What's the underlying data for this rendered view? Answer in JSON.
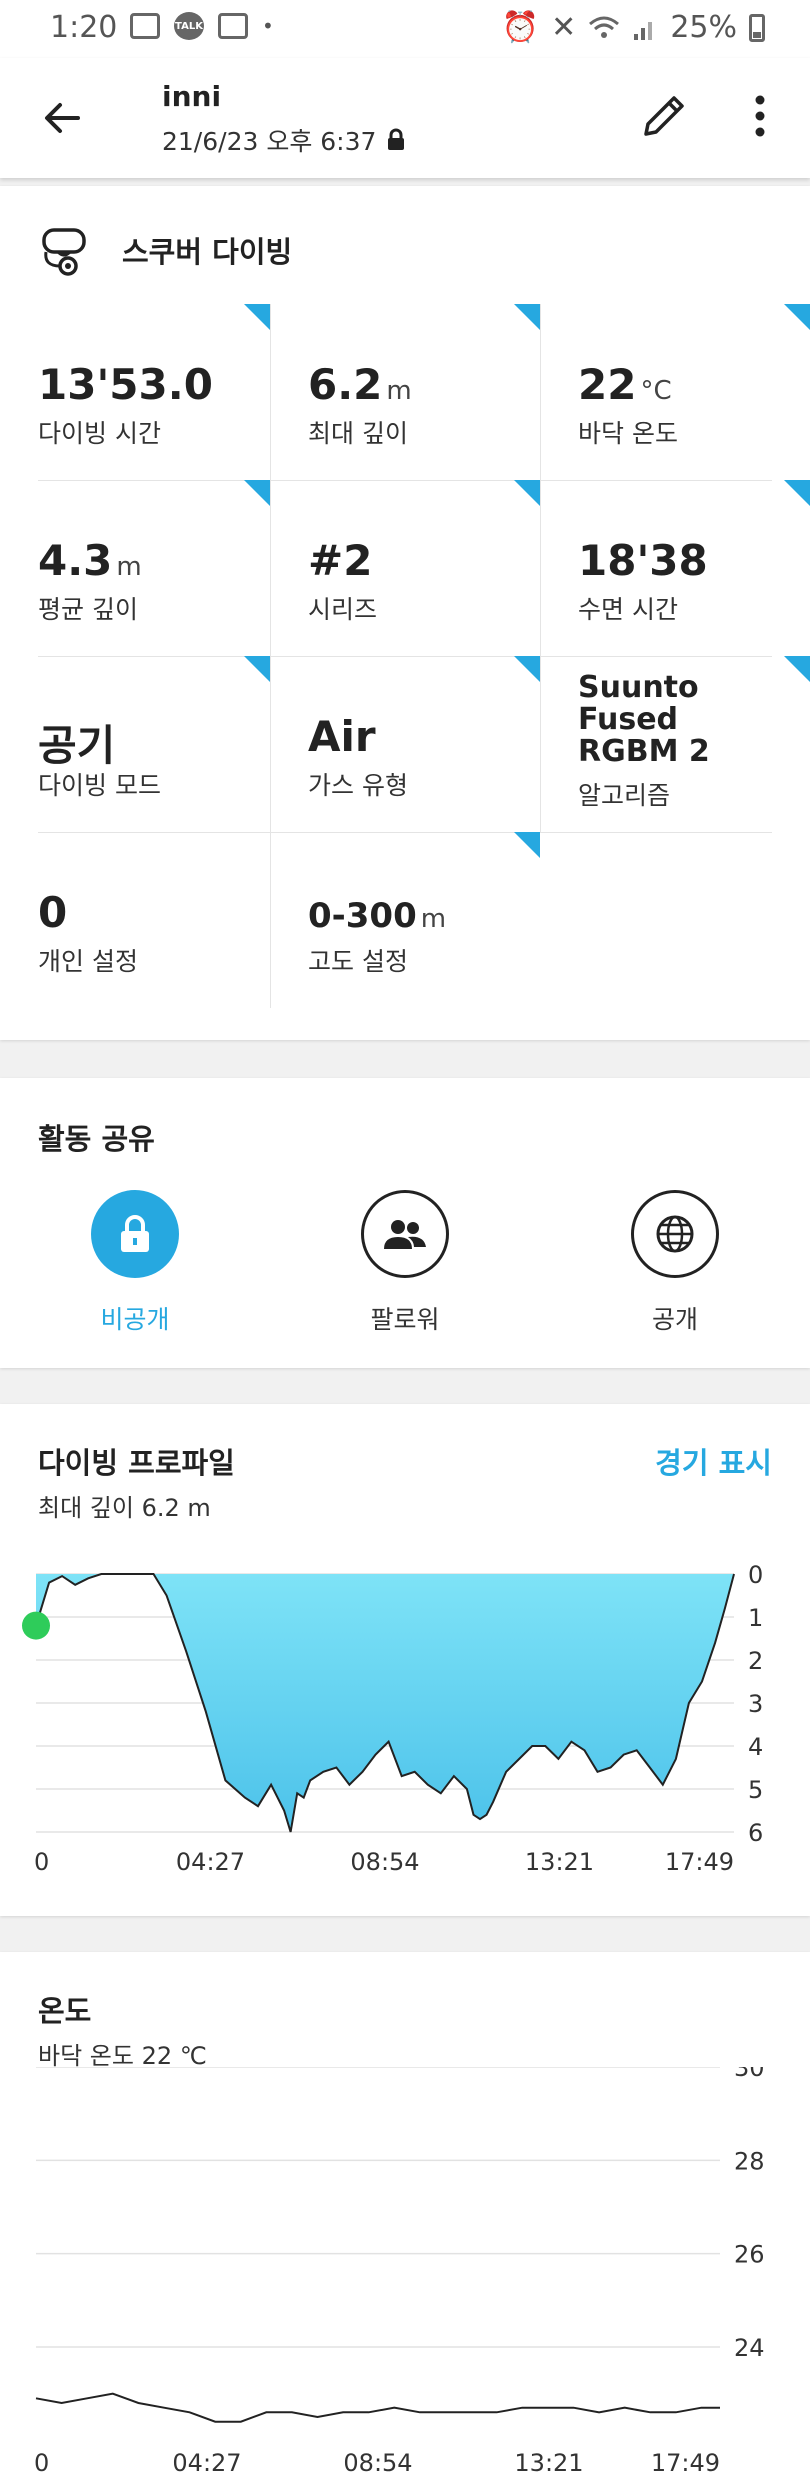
{
  "status_bar": {
    "time": "1:20",
    "battery": "25%",
    "talk_badge": "TALK"
  },
  "header": {
    "title": "inni",
    "subtitle": "21/6/23 오후 6:37"
  },
  "dive": {
    "title": "스쿠버 다이빙",
    "stats": [
      {
        "value": "13'53.0",
        "unit": "",
        "label": "다이빙 시간"
      },
      {
        "value": "6.2",
        "unit": "m",
        "label": "최대 깊이"
      },
      {
        "value": "22",
        "unit": "°C",
        "label": "바닥 온도"
      },
      {
        "value": "4.3",
        "unit": "m",
        "label": "평균 깊이"
      },
      {
        "value": "#2",
        "unit": "",
        "label": "시리즈"
      },
      {
        "value": "18'38",
        "unit": "",
        "label": "수면 시간"
      },
      {
        "value": "공기",
        "unit": "",
        "label": "다이빙 모드"
      },
      {
        "value": "Air",
        "unit": "",
        "label": "가스 유형"
      },
      {
        "value": "Suunto Fused RGBM 2",
        "unit": "",
        "label": "알고리즘"
      },
      {
        "value": "0",
        "unit": "",
        "label": "개인 설정"
      },
      {
        "value": "0-300",
        "unit": "m",
        "label": "고도 설정"
      }
    ]
  },
  "share": {
    "title": "활동 공유",
    "options": [
      {
        "label": "비공개",
        "icon": "lock-icon",
        "active": true
      },
      {
        "label": "팔로워",
        "icon": "followers-icon",
        "active": false
      },
      {
        "label": "공개",
        "icon": "globe-icon",
        "active": false
      }
    ]
  },
  "profile": {
    "title": "다이빙 프로파일",
    "link": "경기 표시",
    "subtitle": "최대 깊이 6.2 m"
  },
  "temperature": {
    "title": "온도",
    "subtitle": "바닥 온도 22 ℃"
  },
  "colors": {
    "accent": "#26a8e0",
    "depth_fill_top": "#7ee3f7",
    "depth_fill_bottom": "#4cc2ea",
    "marker": "#2ecc5a"
  },
  "chart_data": [
    {
      "type": "area",
      "title": "",
      "x_ticks": [
        "0",
        "04:27",
        "08:54",
        "13:21",
        "17:49"
      ],
      "y_ticks": [
        "0",
        "1",
        "2",
        "3",
        "4",
        "5",
        "6"
      ],
      "y_inverted": true,
      "ylim": [
        0,
        6
      ],
      "xlim_seconds": [
        0,
        1069
      ],
      "series": [
        {
          "x_seconds": [
            0,
            20,
            40,
            60,
            80,
            100,
            120,
            140,
            160,
            180,
            200,
            230,
            260,
            290,
            320,
            340,
            360,
            380,
            390,
            400,
            410,
            420,
            440,
            460,
            480,
            500,
            520,
            540,
            560,
            580,
            600,
            620,
            640,
            660,
            670,
            680,
            690,
            700,
            720,
            740,
            760,
            780,
            800,
            820,
            840,
            860,
            880,
            900,
            920,
            940,
            960,
            980,
            1000,
            1020,
            1040,
            1055,
            1069
          ],
          "y": [
            1.2,
            0.2,
            0.05,
            0.25,
            0.1,
            0.0,
            0.0,
            0.0,
            0.0,
            0.0,
            0.5,
            1.8,
            3.2,
            4.8,
            5.2,
            5.4,
            4.9,
            5.5,
            6.0,
            5.1,
            5.2,
            4.8,
            4.6,
            4.5,
            4.9,
            4.6,
            4.2,
            3.9,
            4.7,
            4.6,
            4.9,
            5.1,
            4.7,
            5.0,
            5.6,
            5.7,
            5.6,
            5.3,
            4.6,
            4.3,
            4.0,
            4.0,
            4.3,
            3.9,
            4.1,
            4.6,
            4.5,
            4.2,
            4.1,
            4.5,
            4.9,
            4.3,
            3.0,
            2.5,
            1.6,
            0.8,
            0.0
          ]
        }
      ]
    },
    {
      "type": "line",
      "title": "",
      "x_ticks": [
        "0",
        "04:27",
        "08:54",
        "13:21",
        "17:49"
      ],
      "y_ticks": [
        "30",
        "28",
        "26",
        "24"
      ],
      "ylim": [
        22.5,
        30
      ],
      "xlim_seconds": [
        0,
        1069
      ],
      "series": [
        {
          "x_seconds": [
            0,
            40,
            80,
            120,
            160,
            200,
            240,
            280,
            320,
            360,
            400,
            440,
            480,
            520,
            560,
            600,
            640,
            680,
            720,
            760,
            800,
            840,
            880,
            920,
            960,
            1000,
            1040,
            1069
          ],
          "y": [
            22.9,
            22.8,
            22.9,
            23.0,
            22.8,
            22.7,
            22.6,
            22.4,
            22.4,
            22.6,
            22.6,
            22.5,
            22.6,
            22.6,
            22.7,
            22.6,
            22.6,
            22.6,
            22.6,
            22.7,
            22.7,
            22.7,
            22.6,
            22.7,
            22.6,
            22.6,
            22.7,
            22.7
          ]
        }
      ]
    }
  ]
}
